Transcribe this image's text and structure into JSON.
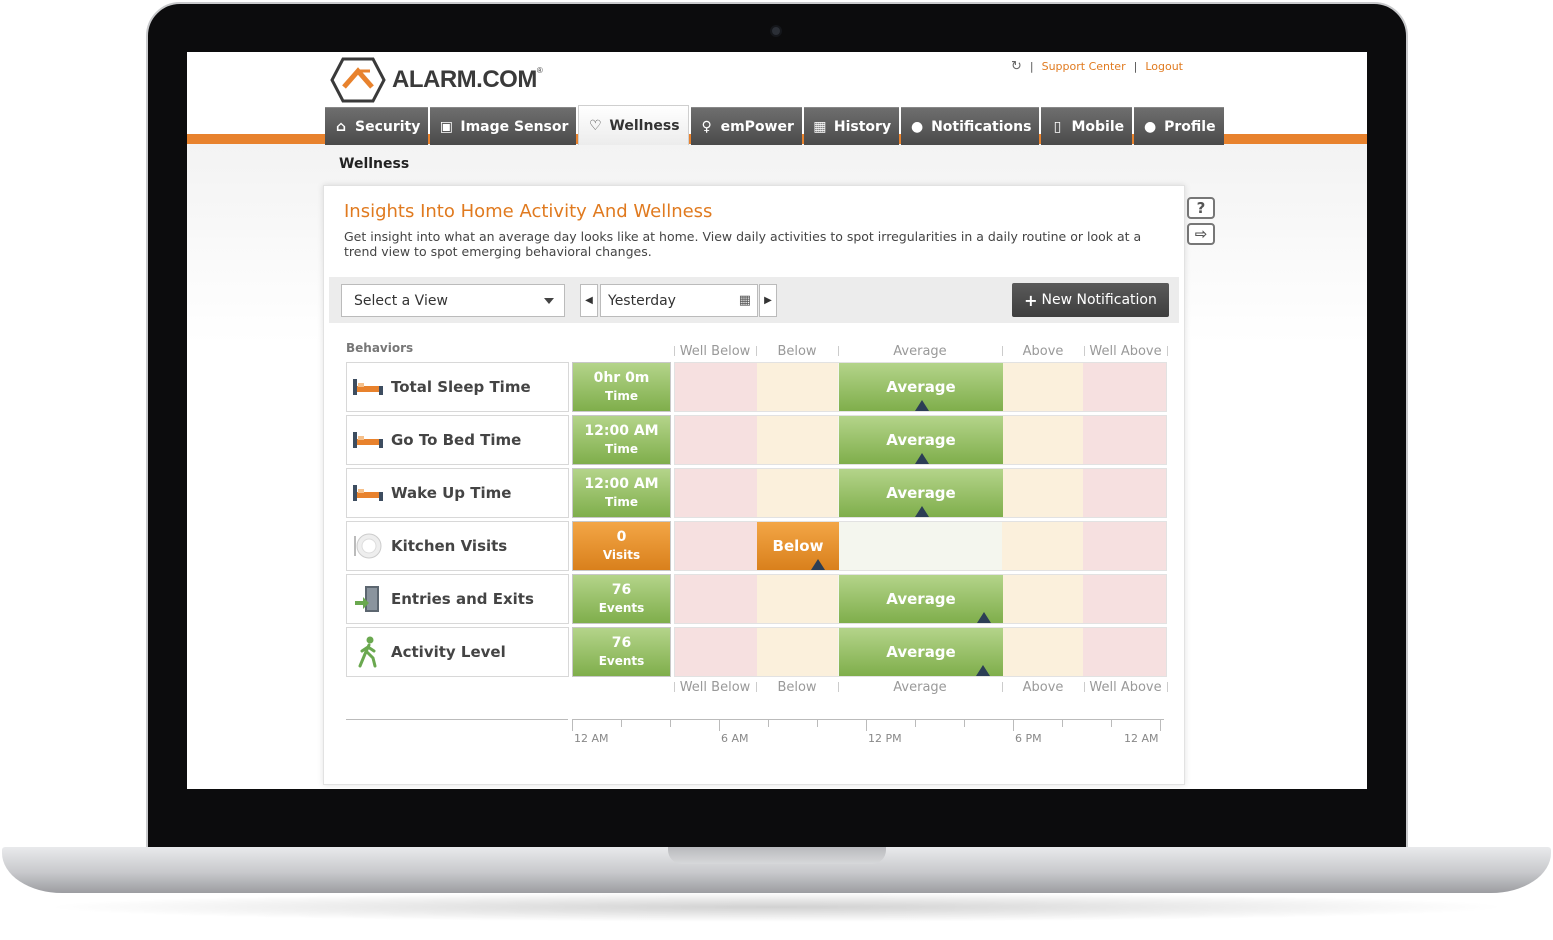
{
  "header": {
    "logo_text": "ALARM.COM",
    "logo_mark": "®",
    "links": {
      "support": "Support Center",
      "logout": "Logout",
      "separator": "|"
    }
  },
  "tabs": [
    {
      "label": "Security",
      "icon": "home-icon"
    },
    {
      "label": "Image Sensor",
      "icon": "image-icon"
    },
    {
      "label": "Wellness",
      "icon": "heart-icon",
      "active": true
    },
    {
      "label": "emPower",
      "icon": "lightbulb-icon"
    },
    {
      "label": "History",
      "icon": "calendar-icon"
    },
    {
      "label": "Notifications",
      "icon": "chat-icon"
    },
    {
      "label": "Mobile",
      "icon": "phone-icon"
    },
    {
      "label": "Profile",
      "icon": "person-icon"
    }
  ],
  "breadcrumb": "Wellness",
  "side_icons": {
    "help": "?",
    "signpost": "⇨"
  },
  "panel": {
    "title": "Insights Into Home Activity And Wellness",
    "description": "Get insight into what an average day looks like at home. View daily activities to spot irregularities in a daily routine or look at a trend view to spot emerging behavioral changes.",
    "view_select": "Select a View",
    "date": "Yesterday",
    "prev": "◀",
    "next": "▶",
    "new_notification": "New Notification"
  },
  "table": {
    "behaviors_label": "Behaviors",
    "columns": [
      "Well Below",
      "Below",
      "Average",
      "Above",
      "Well Above"
    ],
    "rows": [
      {
        "label": "Total Sleep Time",
        "icon": "bed-icon",
        "value": "0hr 0m",
        "unit": "Time",
        "status": "Average",
        "status_color": "green",
        "marker": 0.5
      },
      {
        "label": "Go To Bed Time",
        "icon": "bed-icon",
        "value": "12:00 AM",
        "unit": "Time",
        "status": "Average",
        "status_color": "green",
        "marker": 0.5
      },
      {
        "label": "Wake Up Time",
        "icon": "bed-icon",
        "value": "12:00 AM",
        "unit": "Time",
        "status": "Average",
        "status_color": "green",
        "marker": 0.5
      },
      {
        "label": "Kitchen Visits",
        "icon": "plate-icon",
        "value": "0",
        "unit": "Visits",
        "status": "Below",
        "status_color": "orange",
        "marker": 0.29
      },
      {
        "label": "Entries and Exits",
        "icon": "door-icon",
        "value": "76",
        "unit": "Events",
        "status": "Average",
        "status_color": "green",
        "marker": 0.627
      },
      {
        "label": "Activity Level",
        "icon": "walking-icon",
        "value": "76",
        "unit": "Events",
        "status": "Average",
        "status_color": "green",
        "marker": 0.625
      }
    ]
  },
  "timeline": {
    "labels": [
      "12 AM",
      "6 AM",
      "12 PM",
      "6 PM",
      "12 AM"
    ]
  },
  "colors": {
    "accent": "#e07a1f",
    "green": "#8fbb5a",
    "orange": "#e88f2a",
    "marker": "#2c3e55"
  }
}
